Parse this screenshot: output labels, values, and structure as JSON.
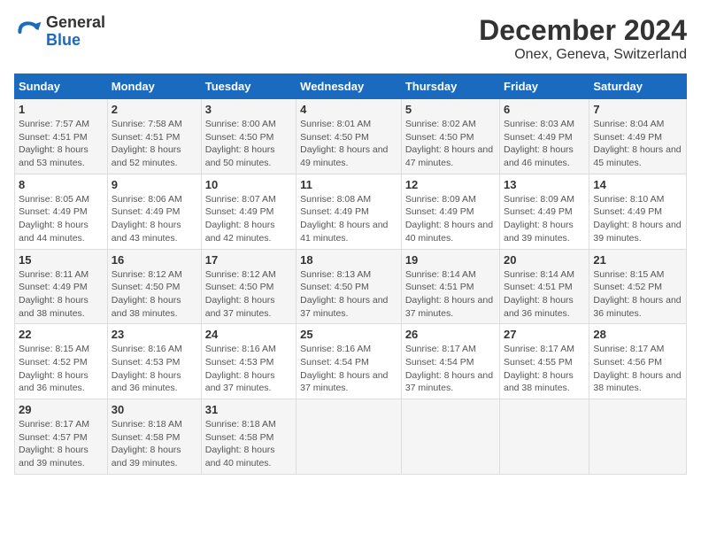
{
  "header": {
    "logo_text_general": "General",
    "logo_text_blue": "Blue",
    "title": "December 2024",
    "subtitle": "Onex, Geneva, Switzerland"
  },
  "calendar": {
    "days_of_week": [
      "Sunday",
      "Monday",
      "Tuesday",
      "Wednesday",
      "Thursday",
      "Friday",
      "Saturday"
    ],
    "weeks": [
      [
        {
          "day": "1",
          "sunrise": "7:57 AM",
          "sunset": "4:51 PM",
          "daylight": "8 hours and 53 minutes."
        },
        {
          "day": "2",
          "sunrise": "7:58 AM",
          "sunset": "4:51 PM",
          "daylight": "8 hours and 52 minutes."
        },
        {
          "day": "3",
          "sunrise": "8:00 AM",
          "sunset": "4:50 PM",
          "daylight": "8 hours and 50 minutes."
        },
        {
          "day": "4",
          "sunrise": "8:01 AM",
          "sunset": "4:50 PM",
          "daylight": "8 hours and 49 minutes."
        },
        {
          "day": "5",
          "sunrise": "8:02 AM",
          "sunset": "4:50 PM",
          "daylight": "8 hours and 47 minutes."
        },
        {
          "day": "6",
          "sunrise": "8:03 AM",
          "sunset": "4:49 PM",
          "daylight": "8 hours and 46 minutes."
        },
        {
          "day": "7",
          "sunrise": "8:04 AM",
          "sunset": "4:49 PM",
          "daylight": "8 hours and 45 minutes."
        }
      ],
      [
        {
          "day": "8",
          "sunrise": "8:05 AM",
          "sunset": "4:49 PM",
          "daylight": "8 hours and 44 minutes."
        },
        {
          "day": "9",
          "sunrise": "8:06 AM",
          "sunset": "4:49 PM",
          "daylight": "8 hours and 43 minutes."
        },
        {
          "day": "10",
          "sunrise": "8:07 AM",
          "sunset": "4:49 PM",
          "daylight": "8 hours and 42 minutes."
        },
        {
          "day": "11",
          "sunrise": "8:08 AM",
          "sunset": "4:49 PM",
          "daylight": "8 hours and 41 minutes."
        },
        {
          "day": "12",
          "sunrise": "8:09 AM",
          "sunset": "4:49 PM",
          "daylight": "8 hours and 40 minutes."
        },
        {
          "day": "13",
          "sunrise": "8:09 AM",
          "sunset": "4:49 PM",
          "daylight": "8 hours and 39 minutes."
        },
        {
          "day": "14",
          "sunrise": "8:10 AM",
          "sunset": "4:49 PM",
          "daylight": "8 hours and 39 minutes."
        }
      ],
      [
        {
          "day": "15",
          "sunrise": "8:11 AM",
          "sunset": "4:49 PM",
          "daylight": "8 hours and 38 minutes."
        },
        {
          "day": "16",
          "sunrise": "8:12 AM",
          "sunset": "4:50 PM",
          "daylight": "8 hours and 38 minutes."
        },
        {
          "day": "17",
          "sunrise": "8:12 AM",
          "sunset": "4:50 PM",
          "daylight": "8 hours and 37 minutes."
        },
        {
          "day": "18",
          "sunrise": "8:13 AM",
          "sunset": "4:50 PM",
          "daylight": "8 hours and 37 minutes."
        },
        {
          "day": "19",
          "sunrise": "8:14 AM",
          "sunset": "4:51 PM",
          "daylight": "8 hours and 37 minutes."
        },
        {
          "day": "20",
          "sunrise": "8:14 AM",
          "sunset": "4:51 PM",
          "daylight": "8 hours and 36 minutes."
        },
        {
          "day": "21",
          "sunrise": "8:15 AM",
          "sunset": "4:52 PM",
          "daylight": "8 hours and 36 minutes."
        }
      ],
      [
        {
          "day": "22",
          "sunrise": "8:15 AM",
          "sunset": "4:52 PM",
          "daylight": "8 hours and 36 minutes."
        },
        {
          "day": "23",
          "sunrise": "8:16 AM",
          "sunset": "4:53 PM",
          "daylight": "8 hours and 36 minutes."
        },
        {
          "day": "24",
          "sunrise": "8:16 AM",
          "sunset": "4:53 PM",
          "daylight": "8 hours and 37 minutes."
        },
        {
          "day": "25",
          "sunrise": "8:16 AM",
          "sunset": "4:54 PM",
          "daylight": "8 hours and 37 minutes."
        },
        {
          "day": "26",
          "sunrise": "8:17 AM",
          "sunset": "4:54 PM",
          "daylight": "8 hours and 37 minutes."
        },
        {
          "day": "27",
          "sunrise": "8:17 AM",
          "sunset": "4:55 PM",
          "daylight": "8 hours and 38 minutes."
        },
        {
          "day": "28",
          "sunrise": "8:17 AM",
          "sunset": "4:56 PM",
          "daylight": "8 hours and 38 minutes."
        }
      ],
      [
        {
          "day": "29",
          "sunrise": "8:17 AM",
          "sunset": "4:57 PM",
          "daylight": "8 hours and 39 minutes."
        },
        {
          "day": "30",
          "sunrise": "8:18 AM",
          "sunset": "4:58 PM",
          "daylight": "8 hours and 39 minutes."
        },
        {
          "day": "31",
          "sunrise": "8:18 AM",
          "sunset": "4:58 PM",
          "daylight": "8 hours and 40 minutes."
        },
        null,
        null,
        null,
        null
      ]
    ]
  }
}
